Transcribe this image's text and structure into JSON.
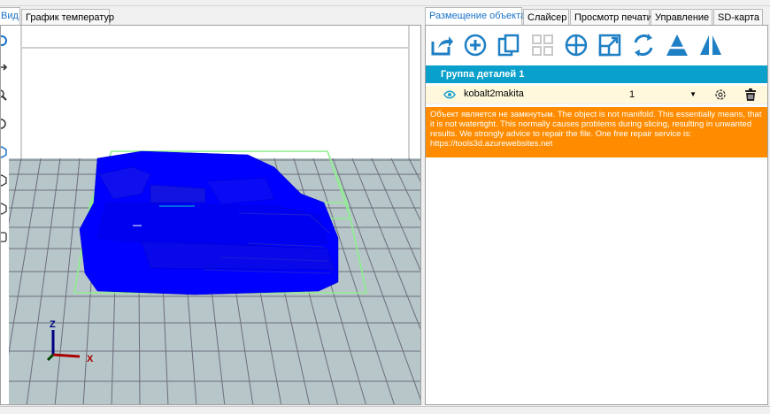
{
  "left_tabs": [
    "Вид",
    "График температур"
  ],
  "right_tabs": [
    "Размещение объекта",
    "Слайсер",
    "Просмотр печати",
    "Управление",
    "SD-карта"
  ],
  "toolbar_icons": [
    "export-icon",
    "add-object-icon",
    "copy-objects-icon",
    "autoposition-icon",
    "center-object-icon",
    "scale-icon",
    "rotate-icon",
    "cut-icon",
    "mirror-icon"
  ],
  "left_tool_icons": [
    "rotate-view-icon",
    "move-view-icon",
    "zoom-icon",
    "reset-view-icon",
    "view-iso-icon",
    "view-front-icon",
    "view-side-icon",
    "view-top-icon"
  ],
  "group_title": "Группа деталей 1",
  "object": {
    "name": "kobalt2makita",
    "copies_value": "1"
  },
  "warning_text": "Объект является не замкнутым. The object is not manifold. This essentially means, that it is not watertight. This normally causes problems during slicing, resulting in unwanted results. We strongly advice to repair the file. One free repair service is: https://tools3d.azurewebsites.net",
  "axes": {
    "z": "Z",
    "x": "X"
  },
  "colors": {
    "accent": "#0aa0cc",
    "warning": "#ff8c00",
    "model": "#0000ff",
    "bed": "#b6c6c9",
    "bbox": "#90ee90",
    "active_tab_text": "#1a73c8"
  }
}
